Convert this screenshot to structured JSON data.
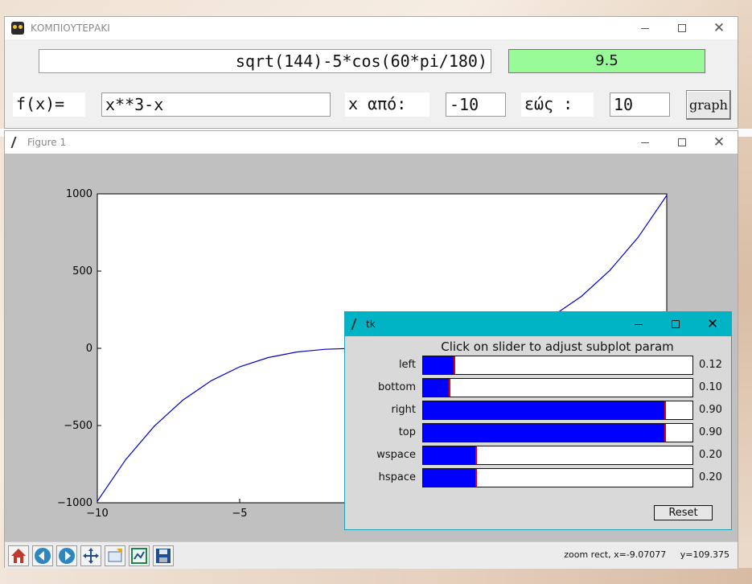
{
  "app": {
    "title": "ΚΟΜΠΙΟΥΤΕΡΑΚΙ",
    "expression": "sqrt(144)-5*cos(60*pi/180)",
    "result": "9.5",
    "fx_label": "f(x)=",
    "fx_value": "x**3-x",
    "from_label": "x από:",
    "from_value": "-10",
    "to_label": "εώς :",
    "to_value": "10",
    "graph_label": "graph",
    "result_color": "#98fb98"
  },
  "figure": {
    "title": "Figure 1",
    "status_mode": "zoom rect, x=-9.07077",
    "status_y": "y=109.375",
    "toolbar": [
      {
        "name": "home-icon"
      },
      {
        "name": "back-icon"
      },
      {
        "name": "forward-icon"
      },
      {
        "name": "pan-icon"
      },
      {
        "name": "zoom-icon"
      },
      {
        "name": "subplots-icon"
      },
      {
        "name": "save-icon"
      }
    ]
  },
  "chart_data": {
    "type": "line",
    "title": "",
    "xlabel": "",
    "ylabel": "",
    "function": "x**3-x",
    "x": [
      -10,
      -9,
      -8,
      -7,
      -6,
      -5,
      -4,
      -3,
      -2,
      -1,
      0,
      1,
      2,
      3,
      4,
      5,
      6,
      7,
      8,
      9,
      10
    ],
    "y": [
      -990,
      -720,
      -504,
      -336,
      -210,
      -120,
      -60,
      -24,
      -6,
      0,
      0,
      0,
      6,
      24,
      60,
      120,
      210,
      336,
      504,
      720,
      990
    ],
    "xlim": [
      -10,
      10
    ],
    "ylim": [
      -1000,
      1000
    ],
    "yticks": [
      "1000",
      "500",
      "0",
      "−500",
      "−1000"
    ],
    "xticks": [
      "−10",
      "−5"
    ],
    "line_color": "#0000cc",
    "grid": false
  },
  "subplot_tool": {
    "title": "tk",
    "heading": "Click on slider to adjust subplot param",
    "sliders": [
      {
        "label": "left",
        "value": 0.12,
        "display": "0.12"
      },
      {
        "label": "bottom",
        "value": 0.1,
        "display": "0.10"
      },
      {
        "label": "right",
        "value": 0.9,
        "display": "0.90"
      },
      {
        "label": "top",
        "value": 0.9,
        "display": "0.90"
      },
      {
        "label": "wspace",
        "value": 0.2,
        "display": "0.20"
      },
      {
        "label": "hspace",
        "value": 0.2,
        "display": "0.20"
      }
    ],
    "reset_label": "Reset",
    "accent_color": "#00b4c6"
  }
}
